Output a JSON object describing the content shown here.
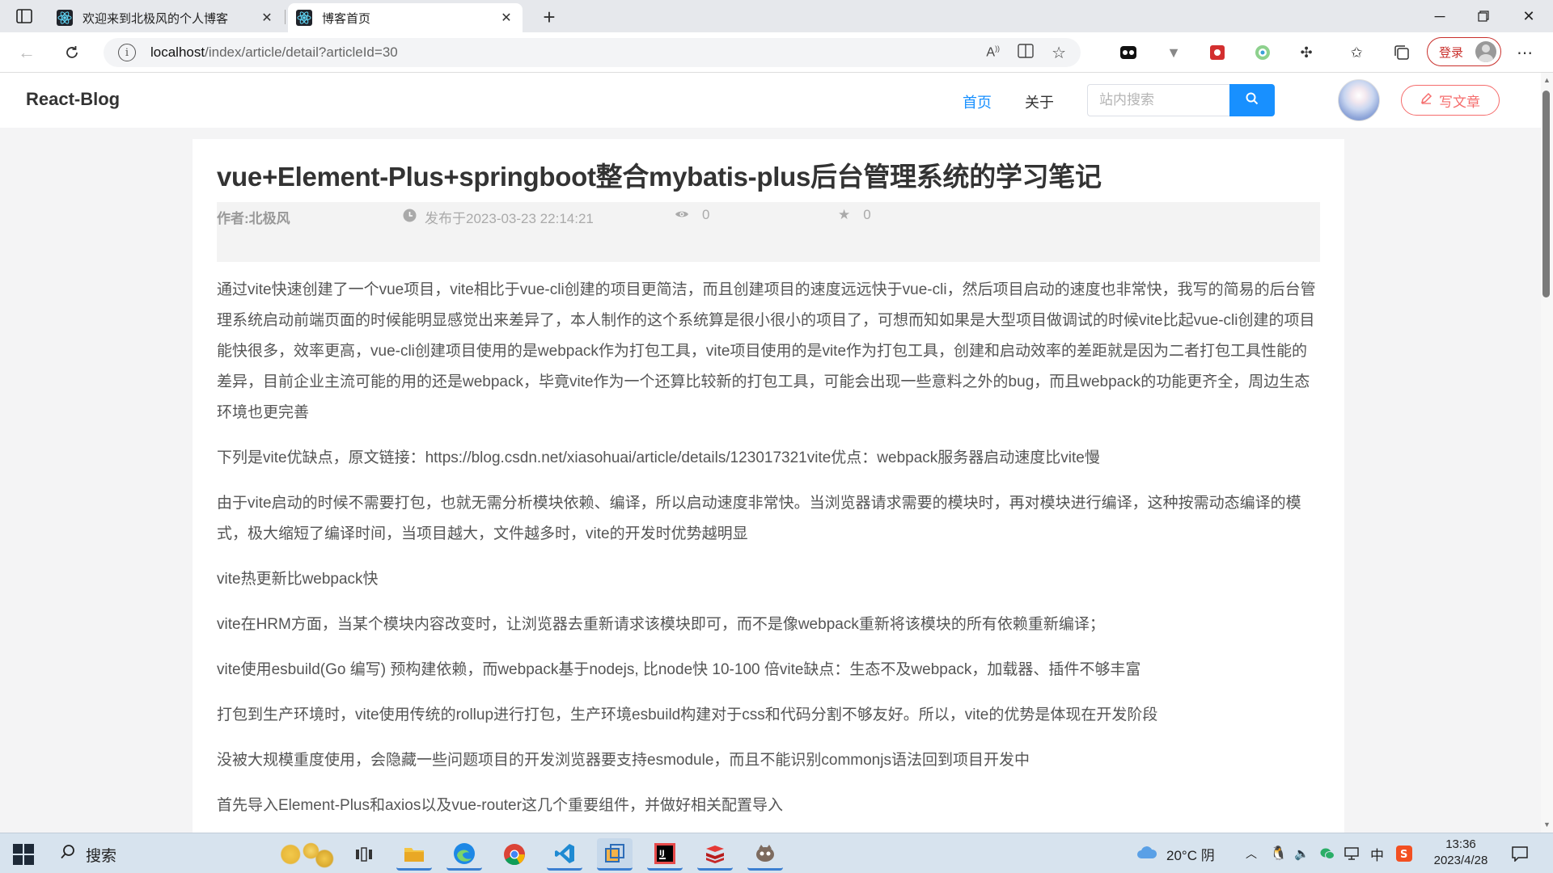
{
  "browser": {
    "tabs": [
      {
        "title": "欢迎来到北极风的个人博客",
        "active": false
      },
      {
        "title": "博客首页",
        "active": true
      }
    ],
    "url": {
      "host": "localhost",
      "path": "/index/article/detail?articleId=30"
    },
    "login_label": "登录"
  },
  "site": {
    "brand": "React-Blog",
    "nav": {
      "home": "首页",
      "about": "关于"
    },
    "search_placeholder": "站内搜索",
    "write_label": "写文章",
    "accent_color": "#1890ff",
    "write_color": "#f56c6c"
  },
  "article": {
    "title": "vue+Element-Plus+springboot整合mybatis-plus后台管理系统的学习笔记",
    "author": "作者:北极风",
    "date": "发布于2023-03-23 22:14:21",
    "views": "0",
    "stars": "0",
    "paragraphs": [
      "通过vite快速创建了一个vue项目，vite相比于vue-cli创建的项目更简洁，而且创建项目的速度远远快于vue-cli，然后项目启动的速度也非常快，我写的简易的后台管理系统启动前端页面的时候能明显感觉出来差异了，本人制作的这个系统算是很小很小的项目了，可想而知如果是大型项目做调试的时候vite比起vue-cli创建的项目能快很多，效率更高，vue-cli创建项目使用的是webpack作为打包工具，vite项目使用的是vite作为打包工具，创建和启动效率的差距就是因为二者打包工具性能的差异，目前企业主流可能的用的还是webpack，毕竟vite作为一个还算比较新的打包工具，可能会出现一些意料之外的bug，而且webpack的功能更齐全，周边生态环境也更完善",
      "下列是vite优缺点，原文链接：https://blog.csdn.net/xiasohuai/article/details/123017321vite优点：webpack服务器启动速度比vite慢",
      "由于vite启动的时候不需要打包，也就无需分析模块依赖、编译，所以启动速度非常快。当浏览器请求需要的模块时，再对模块进行编译，这种按需动态编译的模式，极大缩短了编译时间，当项目越大，文件越多时，vite的开发时优势越明显",
      "vite热更新比webpack快",
      "vite在HRM方面，当某个模块内容改变时，让浏览器去重新请求该模块即可，而不是像webpack重新将该模块的所有依赖重新编译；",
      "vite使用esbuild(Go 编写) 预构建依赖，而webpack基于nodejs, 比node快 10-100 倍vite缺点：生态不及webpack，加载器、插件不够丰富",
      "打包到生产环境时，vite使用传统的rollup进行打包，生产环境esbuild构建对于css和代码分割不够友好。所以，vite的优势是体现在开发阶段",
      "没被大规模重度使用，会隐藏一些问题项目的开发浏览器要支持esmodule，而且不能识别commonjs语法回到项目开发中",
      "首先导入Element-Plus和axios以及vue-router这几个重要组件，并做好相关配置导入"
    ]
  },
  "taskbar": {
    "search_label": "搜索",
    "weather": "20°C 阴",
    "ime": "中",
    "time": "13:36",
    "date": "2023/4/28"
  }
}
